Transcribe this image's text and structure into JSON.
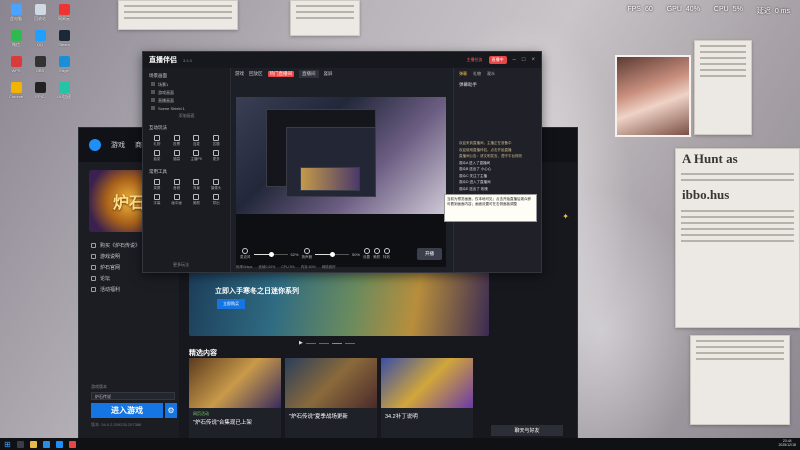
{
  "perf": {
    "fps_label": "FPS",
    "fps_value": "60",
    "gpu_label": "GPU",
    "gpu_value": "40%",
    "cpu_label": "CPU",
    "cpu_value": "5%",
    "latency_label": "延迟",
    "latency_value": "0 ms"
  },
  "desktop": {
    "paper_headline_1": "A Hunt as",
    "paper_headline_2": "ibbo.hus",
    "icons": [
      {
        "label": "此电脑",
        "color": "#4aa3ff"
      },
      {
        "label": "回收站",
        "color": "#cfd8e3"
      },
      {
        "label": "网易云",
        "color": "#e33"
      },
      {
        "label": "微信",
        "color": "#2dbb4f"
      },
      {
        "label": "QQ",
        "color": "#1ea0ff"
      },
      {
        "label": "Steam",
        "color": "#1b2838"
      },
      {
        "label": "WPS",
        "color": "#d93b3b"
      },
      {
        "label": "OBS",
        "color": "#333"
      },
      {
        "label": "Edge",
        "color": "#1a8fd6"
      },
      {
        "label": "Chrome",
        "color": "#f2b400"
      },
      {
        "label": "EPIC",
        "color": "#222"
      },
      {
        "label": "UU加速",
        "color": "#27c3a6"
      }
    ]
  },
  "bnet": {
    "tabs": [
      "游戏",
      "商城"
    ],
    "hs_logo": "炉石",
    "side_links": [
      "购买《炉石传说》",
      "游戏说明",
      "炉石官网",
      "论坛",
      "活动福利"
    ],
    "region_label": "游戏版本",
    "region_value": "炉石传说",
    "play_button": "进入游戏",
    "version": "版本: 34.0.2.209235.207386",
    "banner_title": "立即入手寒冬之日迷你系列",
    "banner_button": "立即购买",
    "featured_title": "精选内容",
    "cards": [
      {
        "tag": "网页活动",
        "title": "\"炉石传说\"合集现已上架"
      },
      {
        "tag": "",
        "title": "\"炉石传说\"夏季战场更新"
      },
      {
        "tag": "",
        "title": "34.2补丁说明"
      }
    ],
    "friends_button": "聊天与好友"
  },
  "obs": {
    "title": "直播伴侣",
    "version": "3.4.3",
    "rec_badge": "主播任务",
    "live_badge": "直播中",
    "left": {
      "scene_header": "场景画面",
      "scenes": [
        "场景1",
        "游戏画面",
        "直播画面",
        "Scene Shield 1"
      ],
      "add_scene": "添加画面",
      "tools_header": "互动玩法",
      "tools_a": [
        "礼物",
        "投票",
        "连麦",
        "答题",
        "抽奖",
        "福袋",
        "主播PK",
        "更多"
      ],
      "tools_header_2": "常用工具",
      "tools_b": [
        "录屏",
        "音频",
        "背景",
        "摄像头",
        "字幕",
        "画中画",
        "美颜",
        "导出"
      ],
      "more": "更多玩法"
    },
    "tabs": [
      "游戏",
      "回放区",
      "直播间",
      "竖屏"
    ],
    "hot_tab": "热门直播间",
    "audio": {
      "mic_label": "麦克风",
      "mic_pct": "52%",
      "mic_level": 0.52,
      "spk_label": "扬声器",
      "spk_pct": "50%",
      "spk_level": 0.5,
      "btn1": "设置",
      "btn2": "美颜",
      "btn3": "特效"
    },
    "start_button": "开播",
    "status": [
      "码率0kbps",
      "丢帧0.00%",
      "CPU 5%",
      "内存 60%",
      "网络良好"
    ],
    "chat": {
      "tabs": [
        "弹幕",
        "礼物",
        "观众"
      ],
      "header": "弹幕助手",
      "lines": [
        "欢迎来到直播间，主播正在准备中",
        "欢迎使用直播伴侣，点击开始直播",
        "直播间公告：请文明发言，遵守平台规则",
        "观众A 进入了直播间",
        "观众B 送出了 小心心",
        "观众C 关注了主播",
        "观众D 进入了直播间",
        "观众E 送出了 玫瑰"
      ]
    },
    "tooltip": "当前为预览画面，仅本地可见；点击开始直播后观众即可看到画面内容；画面设置可在右侧面板调整"
  },
  "taskbar": {
    "time": "23:44",
    "date": "2025/12/18"
  }
}
